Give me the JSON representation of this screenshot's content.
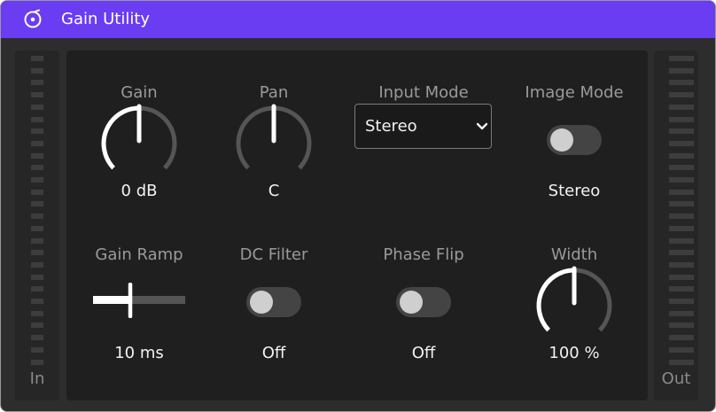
{
  "window": {
    "title": "Gain Utility",
    "icon": "plugin-icon",
    "accent": "#6a3cf2"
  },
  "meters": {
    "in_label": "In",
    "out_label": "Out"
  },
  "controls": {
    "gain": {
      "label": "Gain",
      "value": "0  dB"
    },
    "pan": {
      "label": "Pan",
      "value": "C"
    },
    "input_mode": {
      "label": "Input Mode",
      "selected": "Stereo"
    },
    "image_mode": {
      "label": "Image Mode",
      "value": "Stereo",
      "on": false
    },
    "gain_ramp": {
      "label": "Gain Ramp",
      "value": "10 ms"
    },
    "dc_filter": {
      "label": "DC Filter",
      "value": "Off",
      "on": false
    },
    "phase_flip": {
      "label": "Phase Flip",
      "value": "Off",
      "on": false
    },
    "width": {
      "label": "Width",
      "value": "100  %"
    }
  }
}
